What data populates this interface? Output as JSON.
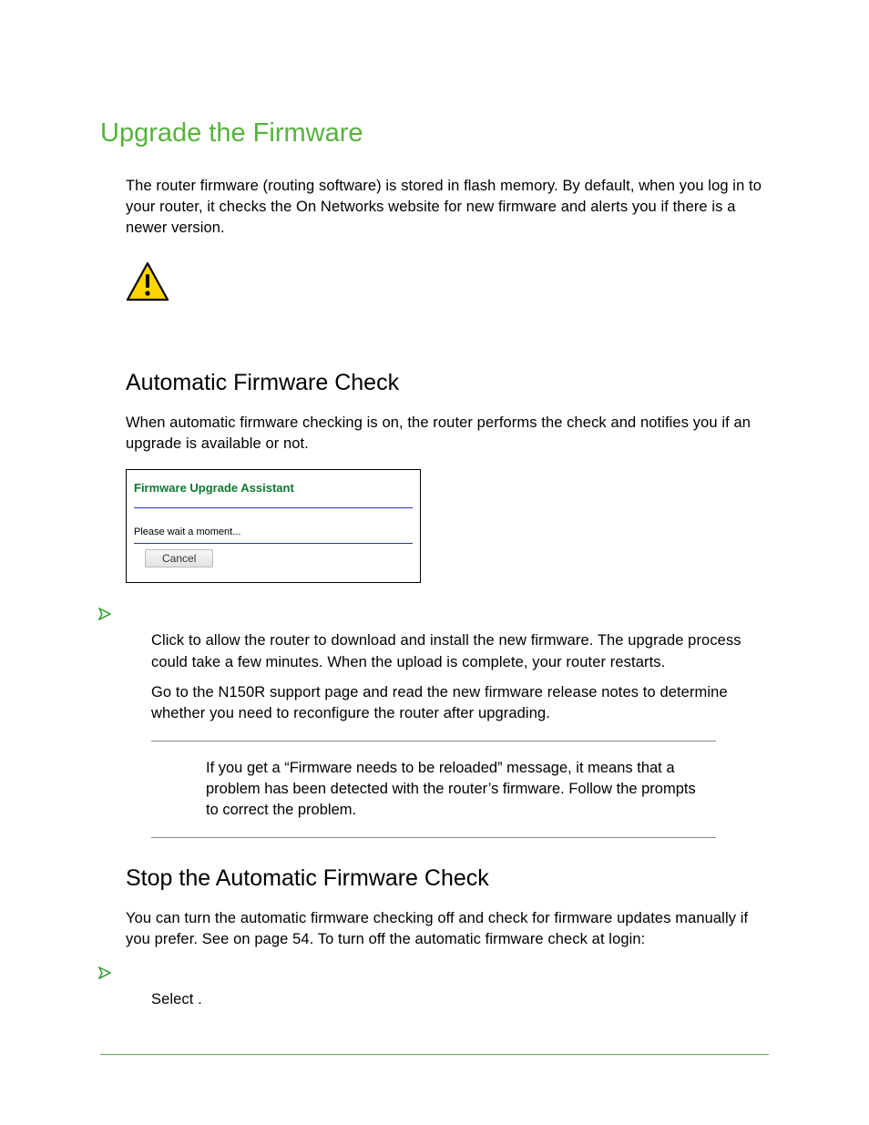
{
  "title": "Upgrade the Firmware",
  "intro": "The router firmware (routing software) is stored in flash memory. By default, when you log in to your router, it checks the On Networks website for new firmware and alerts you if there is a newer version.",
  "section1": {
    "heading": "Automatic Firmware Check",
    "para": "When automatic firmware checking is on, the router performs the check and notifies you if an upgrade is available or not.",
    "dialog": {
      "title": "Firmware Upgrade Assistant",
      "message": "Please wait a moment...",
      "cancel": "Cancel"
    },
    "step1_prefix": "Click ",
    "step1_rest": " to allow the router to download and install the new firmware. The upgrade process could take a few minutes. When the upload is complete, your router restarts.",
    "step2": "Go to the N150R support page and read the new firmware release notes to determine whether you need to reconfigure the router after upgrading.",
    "note": "If you get a “Firmware needs to be reloaded” message, it means that a problem has been detected with the router’s firmware. Follow the prompts to correct the problem."
  },
  "section2": {
    "heading": "Stop the Automatic Firmware Check",
    "para_prefix": "You can turn the automatic firmware checking off and check for firmware updates manually if you prefer. See ",
    "para_mid": " on page 54. To turn off the automatic firmware check at login:",
    "step1_prefix": "Select ",
    "step1_suffix": "."
  }
}
